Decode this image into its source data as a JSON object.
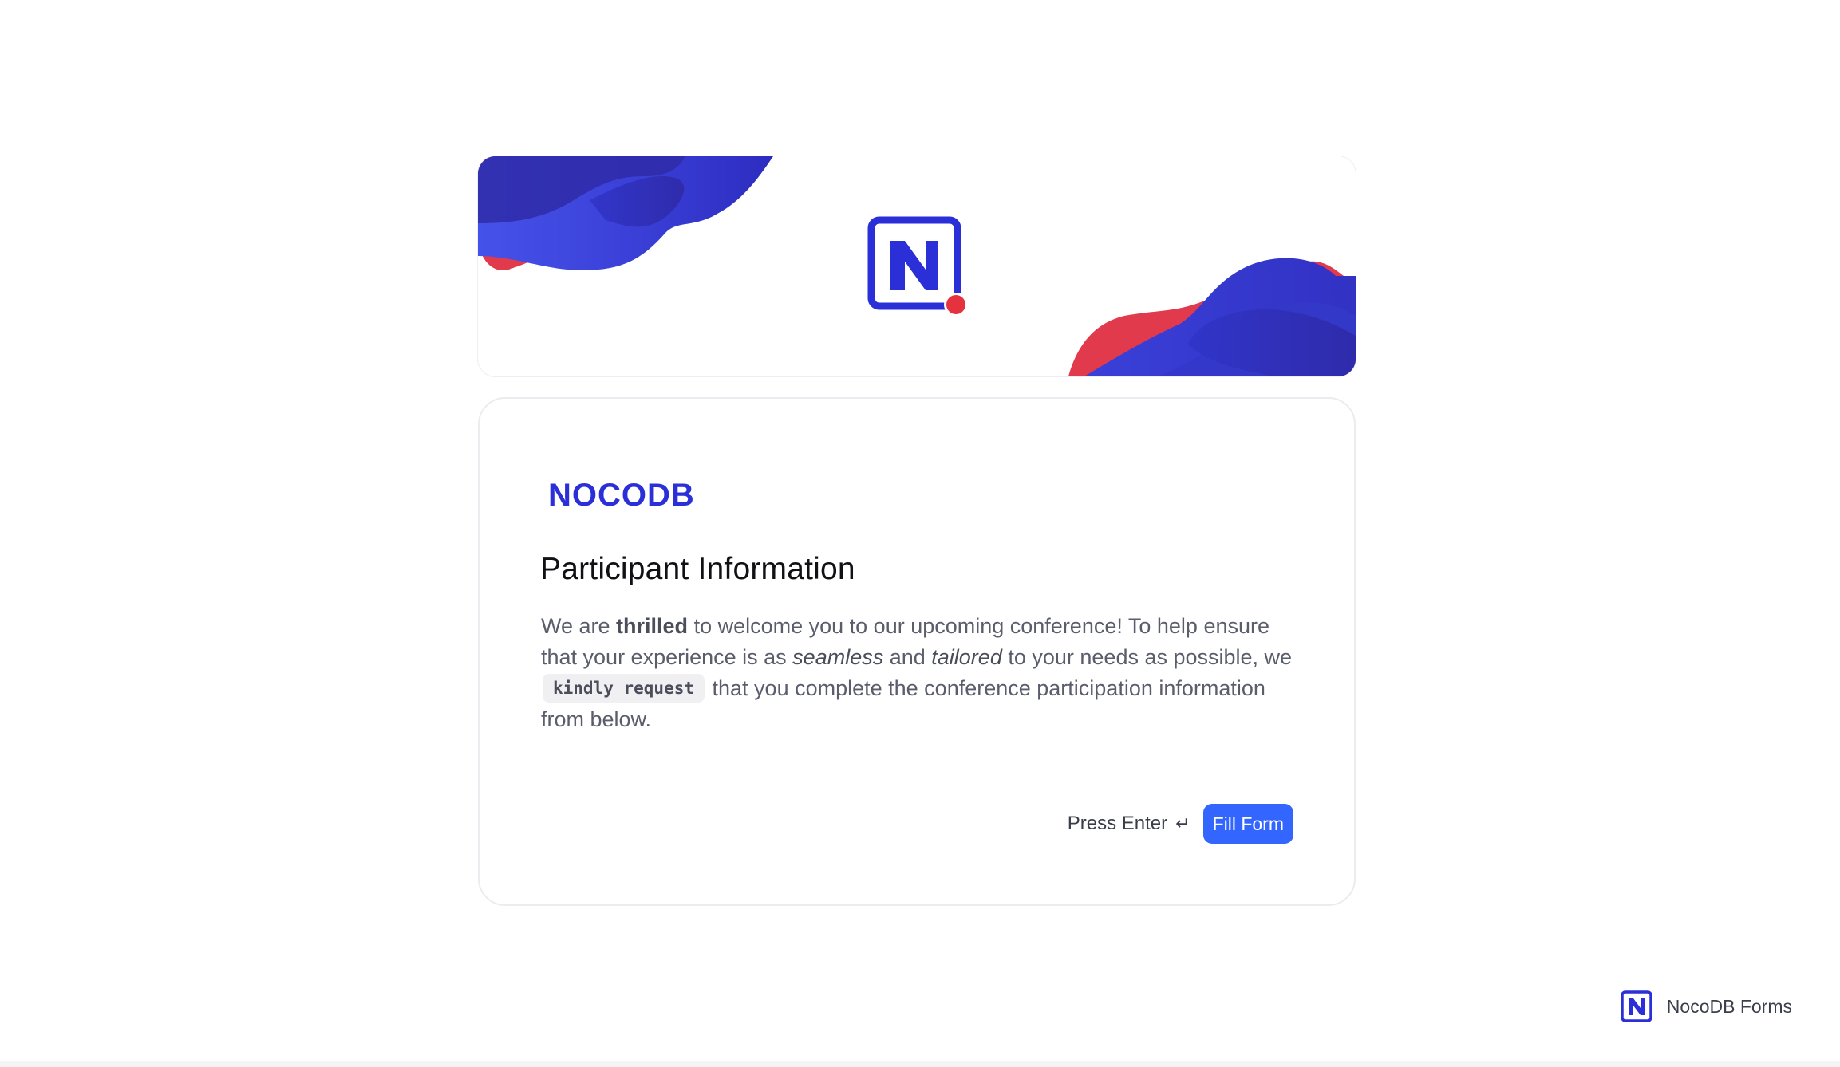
{
  "banner": {
    "logo_icon": "nocodb-icon"
  },
  "card": {
    "brand_logo_text": "NOCODB",
    "title": "Participant Information",
    "description": {
      "part1": "We are ",
      "bold": "thrilled",
      "part2": " to welcome you to our upcoming conference! To help ensure that your experience is as ",
      "italic1": "seamless",
      "part3": " and ",
      "italic2": "tailored",
      "part4": " to your needs as possible, we ",
      "code": "kindly request",
      "part5": " that you complete the conference participation information from below."
    },
    "press_enter_label": "Press Enter",
    "enter_icon": "↵",
    "fill_button_label": "Fill Form"
  },
  "footer": {
    "label": "NocoDB Forms",
    "icon": "nocodb-icon"
  },
  "colors": {
    "accent": "#3366ff",
    "brand_blue": "#2b2fd8",
    "wave_red": "#e23a4d"
  }
}
